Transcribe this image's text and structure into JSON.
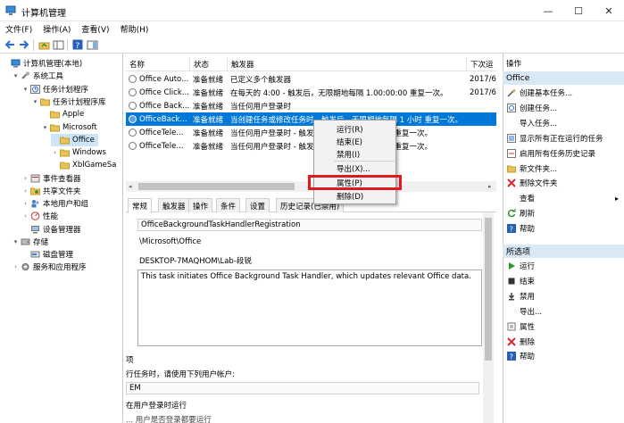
{
  "window": {
    "title": "计算机管理",
    "min": "—",
    "max": "☐",
    "close": "✕"
  },
  "menu": [
    "文件(F)",
    "操作(A)",
    "查看(V)",
    "帮助(H)"
  ],
  "tree": [
    {
      "label": "计算机管理(本地)",
      "level": 0,
      "arrow": "",
      "icon": "computer"
    },
    {
      "label": "系统工具",
      "level": 1,
      "arrow": "▾",
      "icon": "tools"
    },
    {
      "label": "任务计划程序",
      "level": 2,
      "arrow": "▾",
      "icon": "clock"
    },
    {
      "label": "任务计划程序库",
      "level": 3,
      "arrow": "▾",
      "icon": "folder"
    },
    {
      "label": "Apple",
      "level": 4,
      "arrow": "",
      "icon": "folder"
    },
    {
      "label": "Microsoft",
      "level": 4,
      "arrow": "▾",
      "icon": "folder"
    },
    {
      "label": "Office",
      "level": 5,
      "arrow": "",
      "icon": "folder",
      "selected": true
    },
    {
      "label": "Windows",
      "level": 5,
      "arrow": "›",
      "icon": "folder"
    },
    {
      "label": "XblGameSa",
      "level": 5,
      "arrow": "",
      "icon": "folder"
    },
    {
      "label": "事件查看器",
      "level": 2,
      "arrow": "›",
      "icon": "event"
    },
    {
      "label": "共享文件夹",
      "level": 2,
      "arrow": "›",
      "icon": "share"
    },
    {
      "label": "本地用户和组",
      "level": 2,
      "arrow": "›",
      "icon": "users"
    },
    {
      "label": "性能",
      "level": 2,
      "arrow": "›",
      "icon": "perf"
    },
    {
      "label": "设备管理器",
      "level": 2,
      "arrow": "",
      "icon": "device"
    },
    {
      "label": "存储",
      "level": 1,
      "arrow": "▾",
      "icon": "storage"
    },
    {
      "label": "磁盘管理",
      "level": 2,
      "arrow": "",
      "icon": "disk"
    },
    {
      "label": "服务和应用程序",
      "level": 1,
      "arrow": "›",
      "icon": "services"
    }
  ],
  "list": {
    "columns": [
      "名称",
      "状态",
      "触发器",
      "下次运"
    ],
    "rows": [
      {
        "name": "Office Auto...",
        "status": "准备就绪",
        "trigger": "已定义多个触发器",
        "next": "2017/6"
      },
      {
        "name": "Office Click...",
        "status": "准备就绪",
        "trigger": "在每天的 4:00 - 触发后，无限期地每隔 1.00:00:00 重复一次。",
        "next": "2017/6"
      },
      {
        "name": "Office Back...",
        "status": "准备就绪",
        "trigger": "当任何用户登录时",
        "next": ""
      },
      {
        "name": "OfficeBack...",
        "status": "准备就绪",
        "trigger": "当创建任务或修改任务时 - 触发后，无限期地每隔 1 小时 重复一次。",
        "next": "",
        "selected": true
      },
      {
        "name": "OfficeTele...",
        "status": "准备就绪",
        "trigger": "当任何用户登录时 - 触发后，无限期地每隔 1 天 重复一次。",
        "next": ""
      },
      {
        "name": "OfficeTele...",
        "status": "准备就绪",
        "trigger": "当任何用户登录时 - 触发后，无限期地每隔 1 天 重复一次。",
        "next": ""
      }
    ]
  },
  "tabs": [
    "常规",
    "触发器",
    "操作",
    "条件",
    "设置",
    "历史记录(已禁用)"
  ],
  "details": {
    "name": "OfficeBackgroundTaskHandlerRegistration",
    "location": "\\Microsoft\\Office",
    "author": "DESKTOP-7MAQHOM\\Lab-段锐",
    "description": "This task initiates Office Background Task Handler, which updates relevant Office data.",
    "section": "项",
    "runas_label": "行任务时，请使用下列用户帐户:",
    "runas_value": "EM",
    "run_when": "在用户登录时运行",
    "more": "... 用户是否登录都要运行"
  },
  "context_menu": {
    "items": [
      "运行(R)",
      "结束(E)",
      "禁用(I)",
      "导出(X)...",
      "属性(P)",
      "删除(D)"
    ]
  },
  "actions": {
    "header": "操作",
    "section1": "Office",
    "items1": [
      {
        "label": "创建基本任务...",
        "icon": "wand"
      },
      {
        "label": "创建任务...",
        "icon": "task"
      },
      {
        "label": "导入任务...",
        "icon": ""
      },
      {
        "label": "显示所有正在运行的任务",
        "icon": "list"
      },
      {
        "label": "启用所有任务历史记录",
        "icon": "history"
      },
      {
        "label": "新文件夹...",
        "icon": "folder"
      },
      {
        "label": "删除文件夹",
        "icon": "delete"
      },
      {
        "label": "查看",
        "icon": "",
        "submenu": "▸"
      },
      {
        "label": "刷新",
        "icon": "refresh"
      },
      {
        "label": "帮助",
        "icon": "help"
      }
    ],
    "section2": "所选项",
    "items2": [
      {
        "label": "运行",
        "icon": "run"
      },
      {
        "label": "结束",
        "icon": "stop"
      },
      {
        "label": "禁用",
        "icon": "disable"
      },
      {
        "label": "导出...",
        "icon": ""
      },
      {
        "label": "属性",
        "icon": "props"
      },
      {
        "label": "删除",
        "icon": "delete"
      },
      {
        "label": "帮助",
        "icon": "help"
      }
    ]
  }
}
